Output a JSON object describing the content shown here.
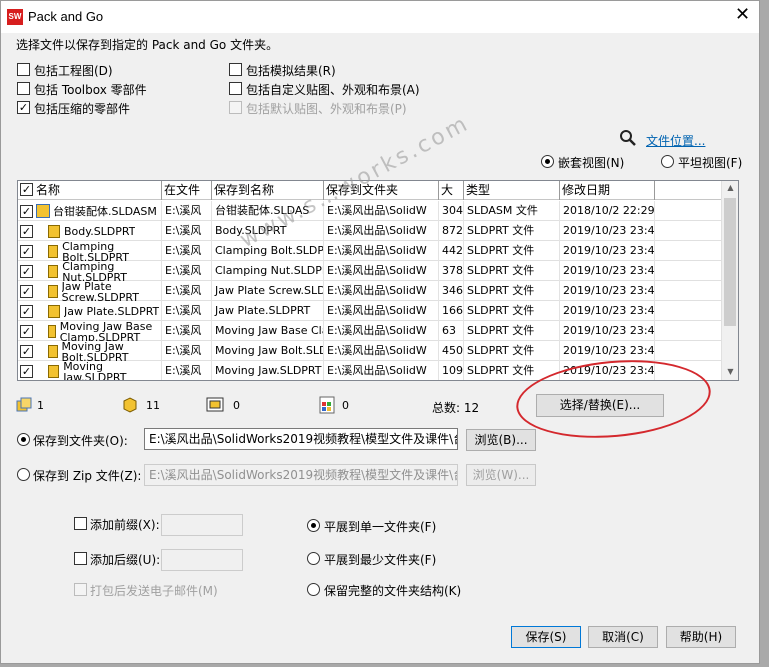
{
  "window": {
    "title": "Pack and Go",
    "close": "✕"
  },
  "intro": "选择文件以保存到指定的 Pack and Go 文件夹。",
  "options": {
    "include_drawings": "包括工程图(D)",
    "include_toolbox": "包括 Toolbox 零部件",
    "include_suppressed": "包括压缩的零部件",
    "include_simulation": "包括模拟结果(R)",
    "include_custom_decals": "包括自定义贴图、外观和布景(A)",
    "include_default_decals": "包括默认贴图、外观和布景(P)",
    "checked_mark": "✓"
  },
  "file_location_link": "文件位置...",
  "view": {
    "nested": "嵌套视图(N)",
    "flat": "平坦视图(F)"
  },
  "table": {
    "headers": [
      "名称",
      "在文件",
      "保存到名称",
      "保存到文件夹",
      "大",
      "类型",
      "修改日期"
    ],
    "rows": [
      {
        "name": "台钳装配体.SLDASM",
        "folder": "E:\\溪风",
        "save_name": "台钳装配体.SLDAS",
        "save_folder": "E:\\溪风出品\\SolidW",
        "size": "304",
        "type": "SLDASM 文件",
        "date": "2018/10/2 22:29:5"
      },
      {
        "name": "Body.SLDPRT",
        "folder": "E:\\溪风",
        "save_name": "Body.SLDPRT",
        "save_folder": "E:\\溪风出品\\SolidW",
        "size": "872",
        "type": "SLDPRT 文件",
        "date": "2019/10/23 23:45:"
      },
      {
        "name": "Clamping Bolt.SLDPRT",
        "folder": "E:\\溪风",
        "save_name": "Clamping Bolt.SLDPR",
        "save_folder": "E:\\溪风出品\\SolidW",
        "size": "442",
        "type": "SLDPRT 文件",
        "date": "2019/10/23 23:45:"
      },
      {
        "name": "Clamping Nut.SLDPRT",
        "folder": "E:\\溪风",
        "save_name": "Clamping Nut.SLDPR",
        "save_folder": "E:\\溪风出品\\SolidW",
        "size": "378",
        "type": "SLDPRT 文件",
        "date": "2019/10/23 23:45:"
      },
      {
        "name": "Jaw Plate Screw.SLDPRT",
        "folder": "E:\\溪风",
        "save_name": "Jaw Plate Screw.SLDP",
        "save_folder": "E:\\溪风出品\\SolidW",
        "size": "346",
        "type": "SLDPRT 文件",
        "date": "2019/10/23 23:45:"
      },
      {
        "name": "Jaw Plate.SLDPRT",
        "folder": "E:\\溪风",
        "save_name": "Jaw Plate.SLDPRT",
        "save_folder": "E:\\溪风出品\\SolidW",
        "size": "166",
        "type": "SLDPRT 文件",
        "date": "2019/10/23 23:45:"
      },
      {
        "name": "Moving Jaw Base Clamp.SLDPRT",
        "folder": "E:\\溪风",
        "save_name": "Moving Jaw Base Cla",
        "save_folder": "E:\\溪风出品\\SolidW",
        "size": "63",
        "type": "SLDPRT 文件",
        "date": "2019/10/23 23:45:"
      },
      {
        "name": "Moving Jaw Bolt.SLDPRT",
        "folder": "E:\\溪风",
        "save_name": "Moving Jaw Bolt.SLD",
        "save_folder": "E:\\溪风出品\\SolidW",
        "size": "450",
        "type": "SLDPRT 文件",
        "date": "2019/10/23 23:45:"
      },
      {
        "name": "Moving Jaw.SLDPRT",
        "folder": "E:\\溪风",
        "save_name": "Moving Jaw.SLDPRT",
        "save_folder": "E:\\溪风出品\\SolidW",
        "size": "109",
        "type": "SLDPRT 文件",
        "date": "2019/10/23 23:45:"
      }
    ]
  },
  "summary": {
    "assemblies": "1",
    "parts": "11",
    "drawings": "0",
    "others": "0",
    "total_label": "总数: 12",
    "select_replace": "选择/替换(E)..."
  },
  "save": {
    "to_folder_label": "保存到文件夹(O):",
    "to_folder_path": "E:\\溪风出品\\SolidWorks2019视频教程\\模型文件及课件\\台",
    "browse": "浏览(B)...",
    "to_zip_label": "保存到 Zip 文件(Z):",
    "to_zip_path": "E:\\溪风出品\\SolidWorks2019视频教程\\模型文件及课件\\台",
    "browse_zip": "浏览(W)..."
  },
  "prefix": "添加前缀(X):",
  "suffix": "添加后缀(U):",
  "email": "打包后发送电子邮件(M)",
  "flatten": {
    "single": "平展到单一文件夹(F)",
    "fewest": "平展到最少文件夹(F)",
    "keep": "保留完整的文件夹结构(K)"
  },
  "buttons": {
    "save": "保存(S)",
    "cancel": "取消(C)",
    "help": "帮助(H)"
  },
  "watermark": "www.s…works.com"
}
